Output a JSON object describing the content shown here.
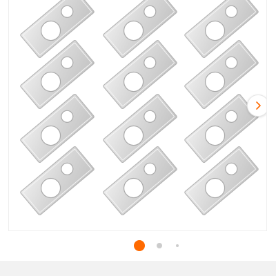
{
  "gallery": {
    "product_image": "product-photo",
    "item_count": 12,
    "next_icon": "chevron-right-icon",
    "carousel": {
      "total_dots": 3,
      "active_index": 1
    },
    "colors": {
      "active_dot": "#ff6a00",
      "inactive_dot": "#cccccc",
      "plate_fill": "#dcdcdc",
      "plate_edge": "#b8b8b8",
      "bottom_bar": "#f2f2f2"
    }
  }
}
